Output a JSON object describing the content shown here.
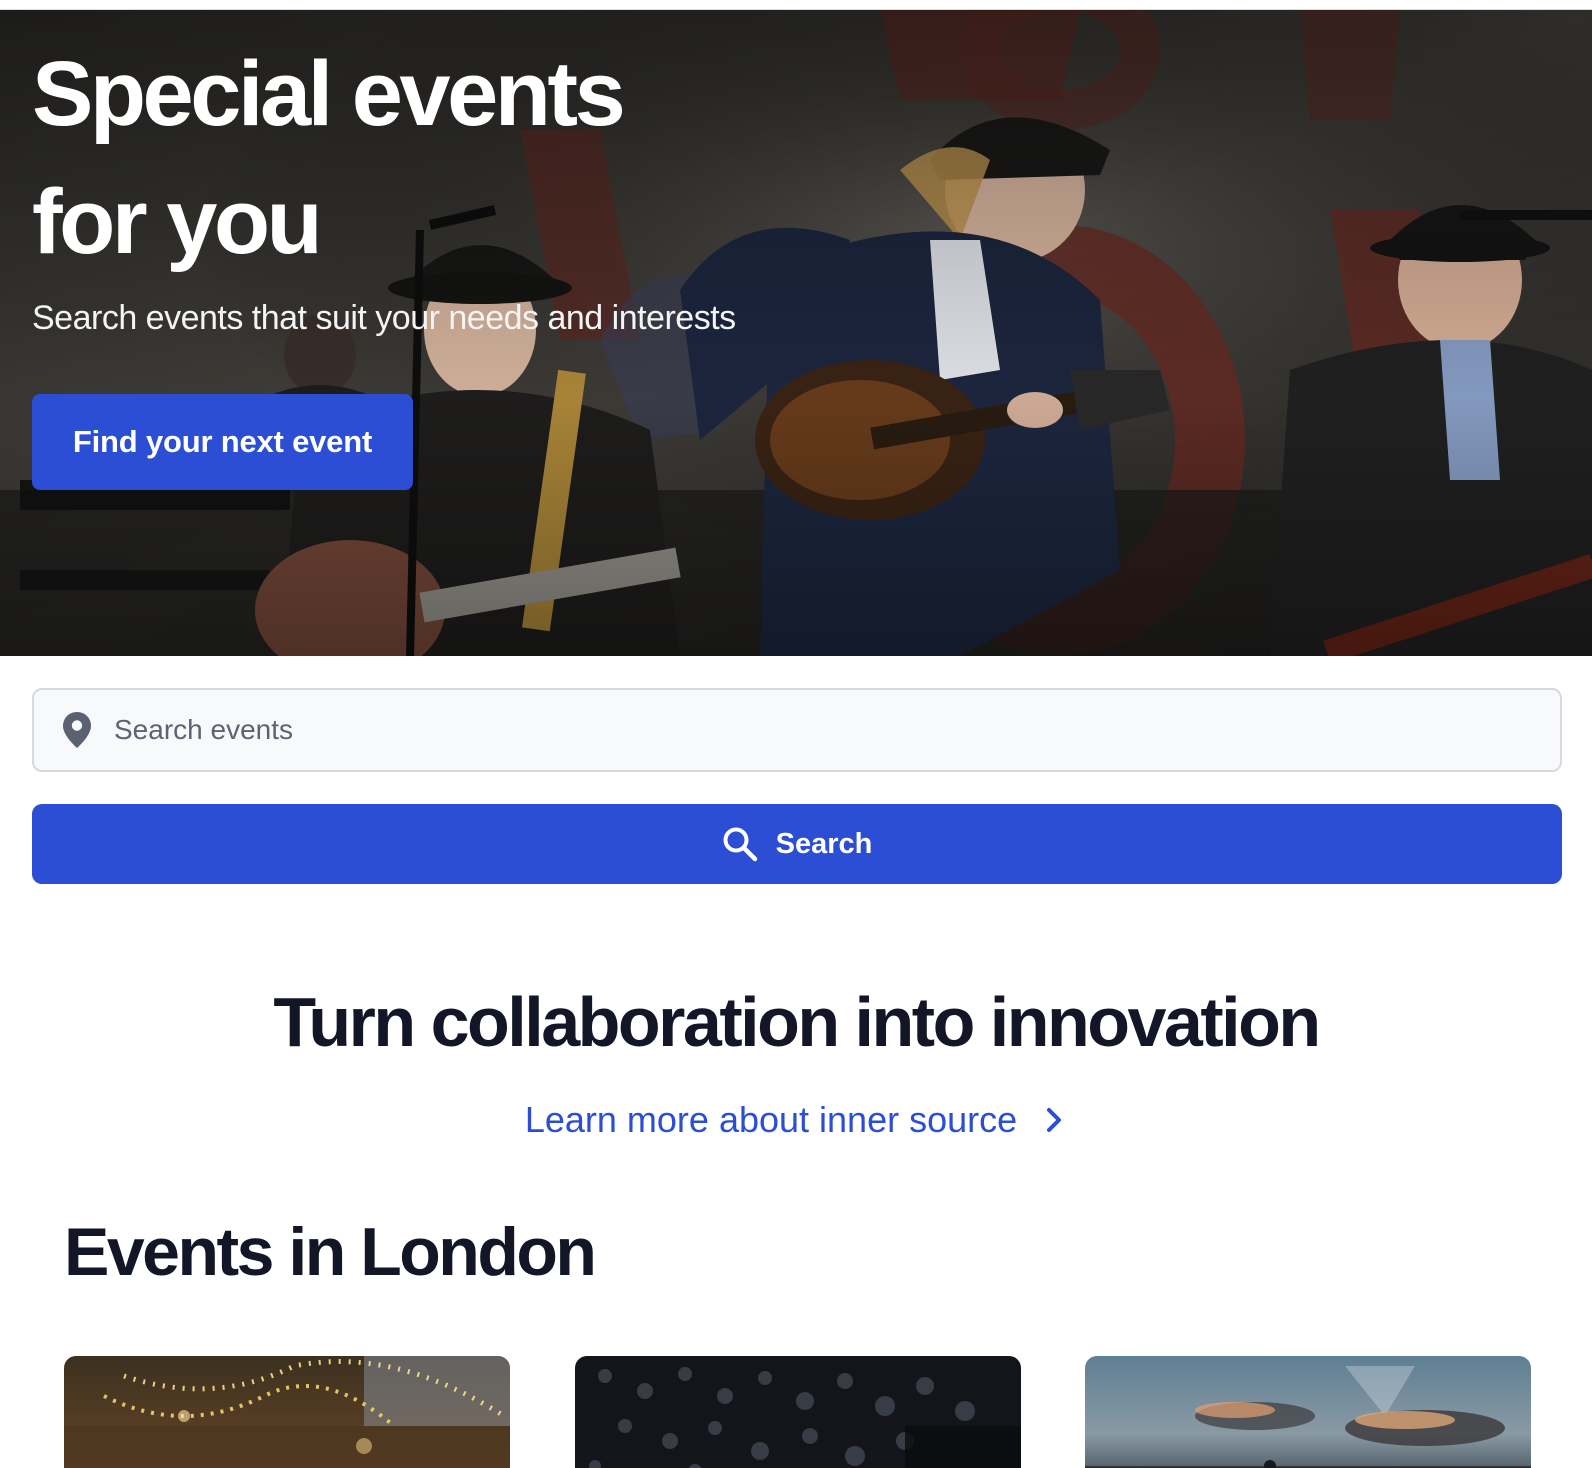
{
  "hero": {
    "title_line1": "Special events",
    "title_line2": "for you",
    "subtitle": "Search events that suit your needs and interests",
    "cta_label": "Find your next event"
  },
  "search": {
    "placeholder": "Search events",
    "location_icon": "map-pin-icon",
    "button_icon": "search-icon",
    "button_label": "Search"
  },
  "promo": {
    "title": "Turn collaboration into innovation",
    "link_label": "Learn more about inner source",
    "link_icon": "chevron-right-icon"
  },
  "events": {
    "title": "Events in London",
    "cards": [
      {
        "image": "string-lights-photo"
      },
      {
        "image": "dark-bokeh-photo"
      },
      {
        "image": "sunset-sky-photo"
      }
    ]
  },
  "colors": {
    "primary": "#2b4ed4",
    "heading": "#121626",
    "field_bg": "#f8f9fb",
    "field_border": "#d7d9de"
  }
}
